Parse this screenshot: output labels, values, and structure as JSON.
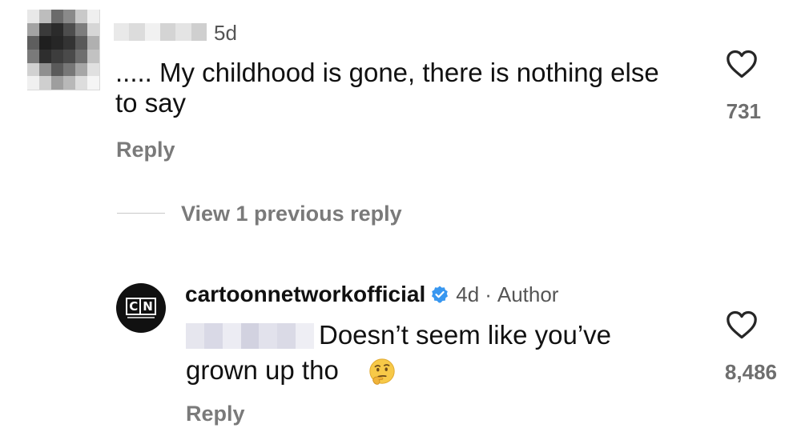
{
  "comment_1": {
    "time": "5d",
    "text": "..... My childhood is gone, there is nothing else to say",
    "reply_label": "Reply",
    "like_count": "731",
    "like_icon": "heart-outline-icon"
  },
  "thread": {
    "view_previous_label": "View 1 previous reply"
  },
  "comment_2": {
    "username": "cartoonnetworkofficial",
    "verified_icon": "verified-badge-icon",
    "time": "4d",
    "separator": "·",
    "author_tag": "Author",
    "text_line_1": "Doesn’t seem like you’ve",
    "text_line_2": "grown up tho",
    "emoji": "thinking-face-emoji",
    "reply_label": "Reply",
    "like_count": "8,486",
    "like_icon": "heart-outline-icon",
    "avatar_logo": "CN"
  },
  "colors": {
    "text_primary": "#111111",
    "text_secondary": "#555555",
    "action_gray": "#7a7a7a",
    "verified_blue": "#3897f0"
  }
}
